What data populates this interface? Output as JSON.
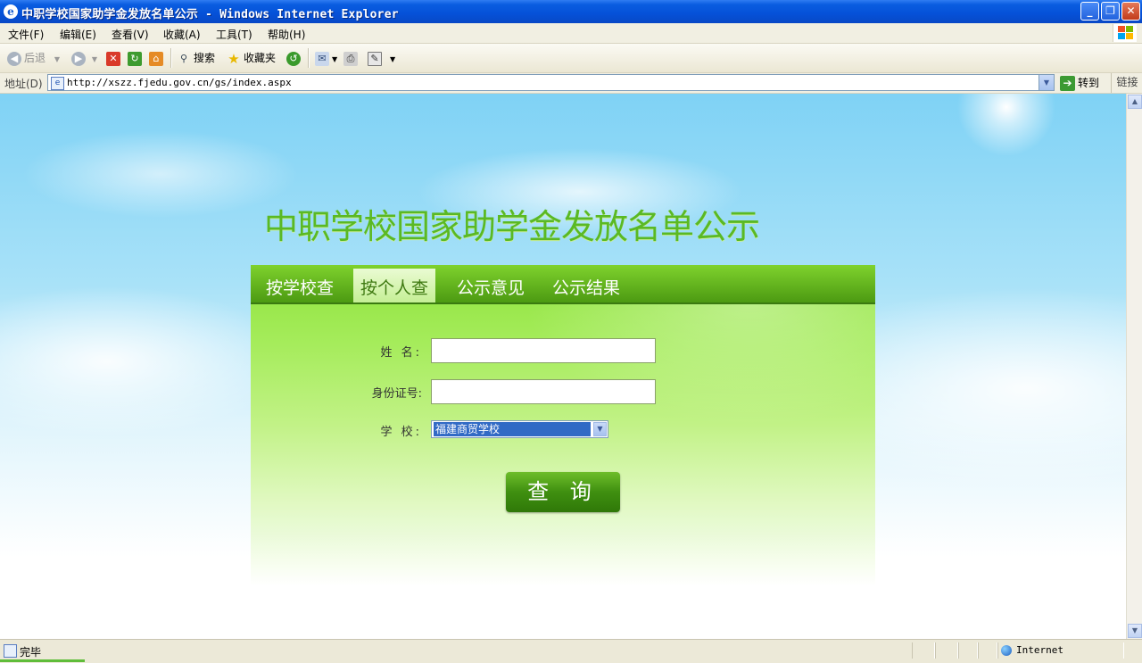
{
  "window": {
    "title": "中职学校国家助学金发放名单公示 - Windows Internet Explorer",
    "buttons": {
      "minimize": "_",
      "maximize": "❐",
      "close": "✕"
    }
  },
  "menu": [
    "文件(F)",
    "编辑(E)",
    "查看(V)",
    "收藏(A)",
    "工具(T)",
    "帮助(H)"
  ],
  "toolbar": {
    "back": "后退",
    "search": "搜索",
    "favorites": "收藏夹"
  },
  "address": {
    "label": "地址(D)",
    "url": "http://xszz.fjedu.gov.cn/gs/index.aspx",
    "go": "转到",
    "links": "链接"
  },
  "page": {
    "heading": "中职学校国家助学金发放名单公示",
    "tabs": [
      "按学校查",
      "按个人查",
      "公示意见",
      "公示结果"
    ],
    "active_tab": "按个人查",
    "form": {
      "name_label": "姓  名:",
      "name_value": "",
      "id_label": "身份证号:",
      "id_value": "",
      "school_label": "学  校:",
      "school_selected": "福建商贸学校",
      "submit": "查 询"
    }
  },
  "status": {
    "text": "完毕",
    "zone": "Internet"
  },
  "colors": {
    "title_heading": "#5ab924",
    "tab_bar": "#4c9a12",
    "query_button": "#3f8f10",
    "titlebar": "#0551d8"
  }
}
